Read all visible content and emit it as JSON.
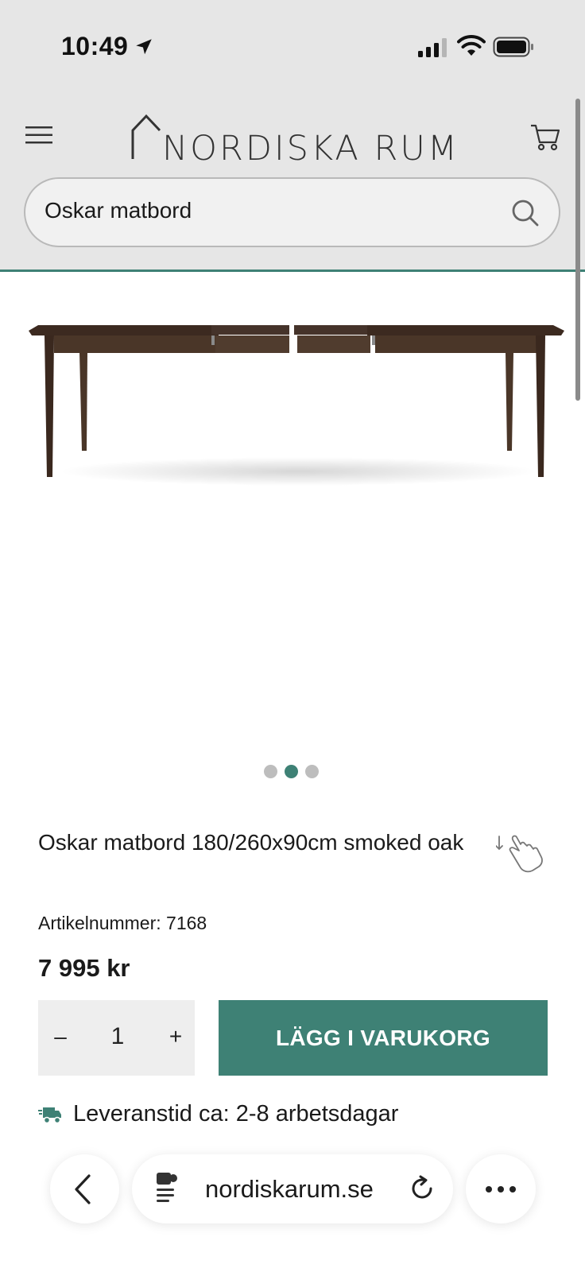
{
  "status_bar": {
    "time": "10:49",
    "icons": [
      "location-arrow-icon",
      "signal-icon",
      "wifi-icon",
      "battery-icon"
    ]
  },
  "header": {
    "logo_text": "NORDISKA RUM",
    "menu_icon": "hamburger-menu-icon",
    "cart_icon": "cart-icon"
  },
  "search": {
    "value": "Oskar matbord",
    "icon": "search-icon"
  },
  "gallery": {
    "image_description_icon": "dining-table-image",
    "slide_count": 3,
    "active_slide": 2
  },
  "product": {
    "title": "Oskar matbord 180/260x90cm smoked oak",
    "sku": "Artikelnummer: 7168",
    "price": "7 995 kr"
  },
  "quantity": {
    "minus_label": "–",
    "value": "1",
    "plus_label": "+"
  },
  "add_to_cart": {
    "label": "LÄGG I VARUKORG"
  },
  "delivery": {
    "text": "Leveranstid ca: 2-8 arbetsdagar",
    "icon": "truck-icon"
  },
  "browser_bar": {
    "url": "nordiskarum.se",
    "icons": [
      "back-icon",
      "page-menu-icon",
      "reload-icon",
      "more-icon"
    ]
  },
  "colors": {
    "accent": "#3e8175",
    "header_bg": "#e6e6e6",
    "button_text": "#ffffff"
  }
}
